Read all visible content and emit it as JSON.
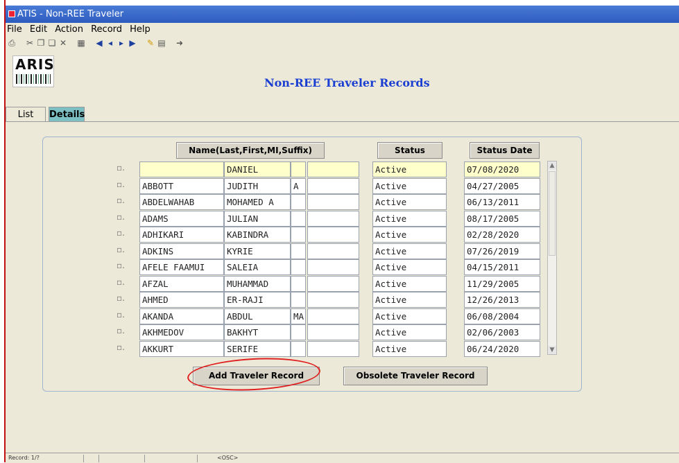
{
  "window": {
    "title": "ATIS - Non-REE Traveler"
  },
  "menu": [
    "File",
    "Edit",
    "Action",
    "Record",
    "Help"
  ],
  "toolbar": {
    "icons": [
      "print-icon",
      "cut-icon",
      "copy-icon",
      "paste-icon",
      "clear-icon",
      "duplicate-icon",
      "first-record-icon",
      "previous-record-icon",
      "next-record-icon",
      "last-record-icon",
      "edit-icon",
      "query-icon",
      "exit-icon"
    ]
  },
  "header": {
    "logo_text": "ARIS",
    "title": "Non-REE Traveler Records"
  },
  "tabs": [
    {
      "label": "List",
      "active": false
    },
    {
      "label": "Details",
      "active": true
    }
  ],
  "columns": {
    "name": "Name(Last,First,MI,Suffix)",
    "status": "Status",
    "status_date": "Status Date"
  },
  "rows": [
    {
      "last": "",
      "first": "DANIEL",
      "mi": "",
      "suffix": "",
      "status": "Active",
      "date": "07/08/2020",
      "current": true
    },
    {
      "last": "ABBOTT",
      "first": "JUDITH",
      "mi": "A",
      "suffix": "",
      "status": "Active",
      "date": "04/27/2005"
    },
    {
      "last": "ABDELWAHAB",
      "first": "MOHAMED A",
      "mi": "",
      "suffix": "",
      "status": "Active",
      "date": "06/13/2011"
    },
    {
      "last": "ADAMS",
      "first": "JULIAN",
      "mi": "",
      "suffix": "",
      "status": "Active",
      "date": "08/17/2005"
    },
    {
      "last": "ADHIKARI",
      "first": "KABINDRA",
      "mi": "",
      "suffix": "",
      "status": "Active",
      "date": "02/28/2020"
    },
    {
      "last": "ADKINS",
      "first": "KYRIE",
      "mi": "",
      "suffix": "",
      "status": "Active",
      "date": "07/26/2019"
    },
    {
      "last": "AFELE FAAMUI",
      "first": "SALEIA",
      "mi": "",
      "suffix": "",
      "status": "Active",
      "date": "04/15/2011"
    },
    {
      "last": "AFZAL",
      "first": "MUHAMMAD",
      "mi": "",
      "suffix": "",
      "status": "Active",
      "date": "11/29/2005"
    },
    {
      "last": "AHMED",
      "first": "ER-RAJI",
      "mi": "",
      "suffix": "",
      "status": "Active",
      "date": "12/26/2013"
    },
    {
      "last": "AKANDA",
      "first": "ABDUL",
      "mi": "MA",
      "suffix": "",
      "status": "Active",
      "date": "06/08/2004"
    },
    {
      "last": "AKHMEDOV",
      "first": "BAKHYT",
      "mi": "",
      "suffix": "",
      "status": "Active",
      "date": "02/06/2003"
    },
    {
      "last": "AKKURT",
      "first": "SERIFE",
      "mi": "",
      "suffix": "",
      "status": "Active",
      "date": "06/24/2020"
    }
  ],
  "buttons": {
    "add": "Add Traveler Record",
    "obsolete": "Obsolete Traveler Record"
  },
  "status_bar": {
    "record": "Record: 1/?",
    "mode": "<OSC>"
  },
  "colors": {
    "title_blue": "#1a3ed1",
    "active_tab": "#7cc0c4",
    "current_row": "#ffffcc",
    "annotation_red": "#e02020"
  }
}
